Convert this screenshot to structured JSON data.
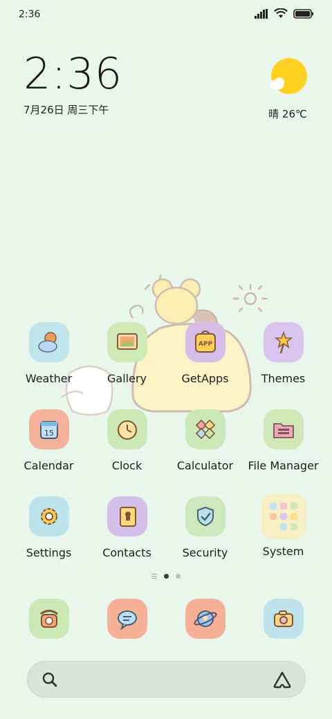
{
  "status": {
    "time": "2:36",
    "icons": [
      "signal-icon",
      "wifi-icon",
      "battery-icon"
    ]
  },
  "clock": {
    "time": "2:36",
    "date": "7月26日 周三下午"
  },
  "weather": {
    "text": "晴 26℃",
    "icon": "sun-cloud-icon"
  },
  "apps": {
    "weather": "Weather",
    "gallery": "Gallery",
    "getapps": "GetApps",
    "themes": "Themes",
    "calendar": "Calendar",
    "clock": "Clock",
    "calculator": "Calculator",
    "filemanager": "File Manager",
    "settings": "Settings",
    "contacts": "Contacts",
    "security": "Security",
    "system": "System"
  },
  "calendar_day": "15",
  "getapps_badge": "APP",
  "pager": {
    "pages": 2,
    "active": 1
  },
  "dock": [
    "phone-icon",
    "messages-icon",
    "browser-icon",
    "camera-icon"
  ],
  "colors": {
    "background": "#e8f6ec",
    "sun": "#ffd21f"
  }
}
